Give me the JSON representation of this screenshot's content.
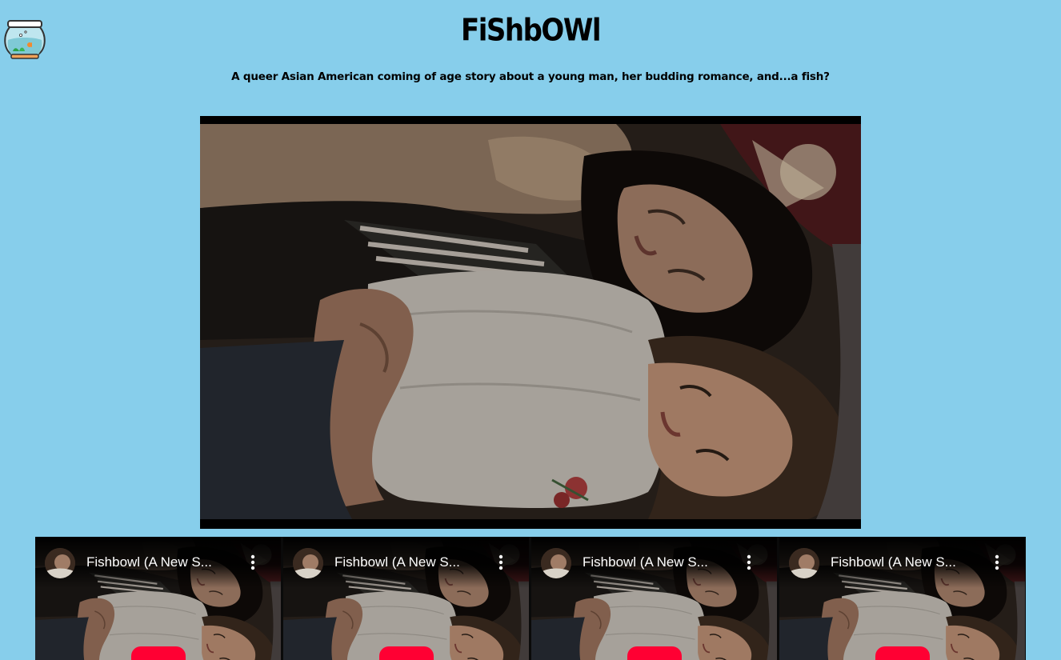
{
  "header": {
    "title": "FiShbOWl",
    "subtitle": "A queer Asian American coming of age story about a young man, her budding romance, and...a fish?",
    "logo_icon": "fishbowl-icon"
  },
  "hero": {
    "icon": "film-still-image"
  },
  "videos": [
    {
      "title": "Fishbowl (A New S...",
      "menu_icon": "more-vertical-icon",
      "play_icon": "play-icon"
    },
    {
      "title": "Fishbowl (A New S...",
      "menu_icon": "more-vertical-icon",
      "play_icon": "play-icon"
    },
    {
      "title": "Fishbowl (A New S...",
      "menu_icon": "more-vertical-icon",
      "play_icon": "play-icon"
    },
    {
      "title": "Fishbowl (A New S...",
      "menu_icon": "more-vertical-icon",
      "play_icon": "play-icon"
    }
  ],
  "colors": {
    "background": "#87ceeb",
    "play_button": "#ff0033"
  }
}
